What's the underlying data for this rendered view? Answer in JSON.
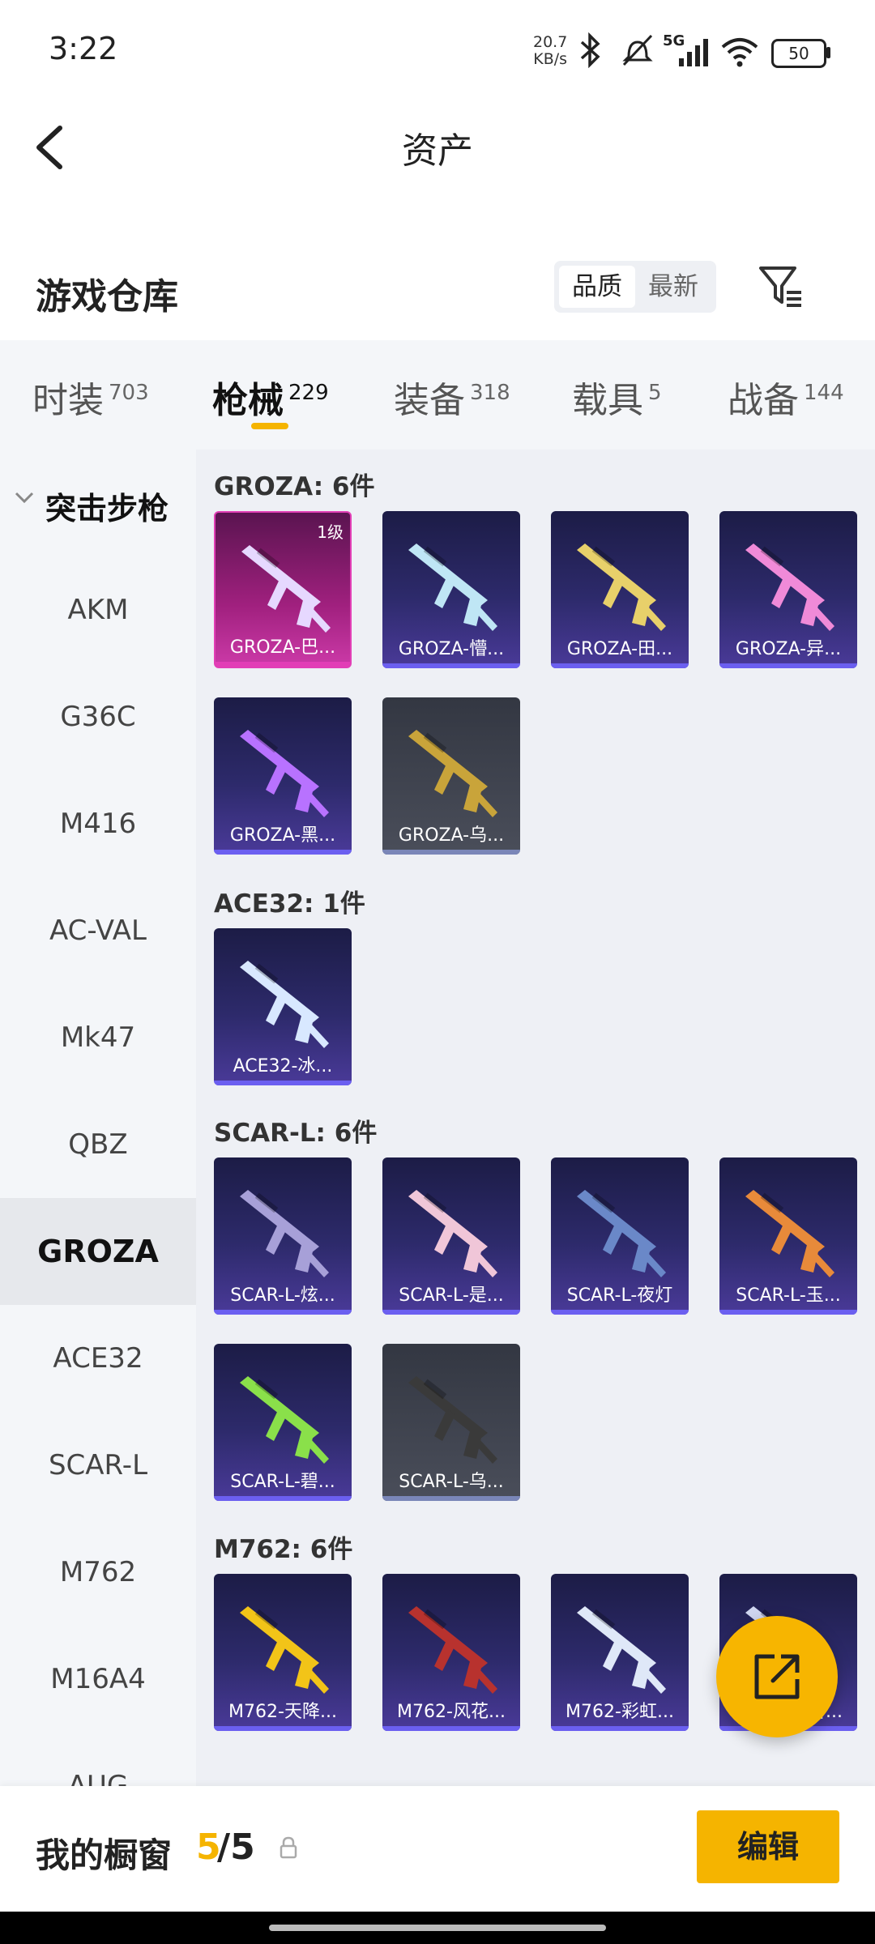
{
  "status": {
    "time": "3:22",
    "net_speed": "20.7",
    "net_unit": "KB/s",
    "battery": "50",
    "signal_label": "5G"
  },
  "header": {
    "title": "资产"
  },
  "section": {
    "title": "游戏仓库",
    "sort_options": [
      "品质",
      "最新"
    ]
  },
  "tabs": [
    {
      "label": "时装",
      "count": "703"
    },
    {
      "label": "枪械",
      "count": "229"
    },
    {
      "label": "装备",
      "count": "318"
    },
    {
      "label": "载具",
      "count": "5"
    },
    {
      "label": "战备",
      "count": "144"
    }
  ],
  "sidebar": {
    "group": "突击步枪",
    "items": [
      "AKM",
      "G36C",
      "M416",
      "AC-VAL",
      "Mk47",
      "QBZ",
      "GROZA",
      "ACE32",
      "SCAR-L",
      "M762",
      "M16A4",
      "AUG"
    ]
  },
  "categories": [
    {
      "title": "GROZA: 6件",
      "items": [
        {
          "name": "GROZA-巴...",
          "level": "1级",
          "style": "pink",
          "color": "#e6d8ff"
        },
        {
          "name": "GROZA-懵...",
          "style": "blue",
          "color": "#bfe6f5"
        },
        {
          "name": "GROZA-田...",
          "style": "blue",
          "color": "#e8d06a"
        },
        {
          "name": "GROZA-异...",
          "style": "blue",
          "color": "#f08ad8"
        },
        {
          "name": "GROZA-黑...",
          "style": "blue",
          "color": "#b872ff"
        },
        {
          "name": "GROZA-乌...",
          "style": "gray",
          "color": "#c9a43a"
        }
      ]
    },
    {
      "title": "ACE32: 1件",
      "items": [
        {
          "name": "ACE32-冰...",
          "style": "blue",
          "color": "#d8e8ff"
        }
      ]
    },
    {
      "title": "SCAR-L: 6件",
      "items": [
        {
          "name": "SCAR-L-炫...",
          "style": "blue",
          "color": "#a7a0d8"
        },
        {
          "name": "SCAR-L-是...",
          "style": "blue",
          "color": "#f0c6d8"
        },
        {
          "name": "SCAR-L-夜灯",
          "style": "blue",
          "color": "#6a88c8"
        },
        {
          "name": "SCAR-L-玉...",
          "style": "blue",
          "color": "#e88a3a"
        },
        {
          "name": "SCAR-L-碧...",
          "style": "blue",
          "color": "#8ae04a"
        },
        {
          "name": "SCAR-L-乌...",
          "style": "gray",
          "color": "#3a3a3a"
        }
      ]
    },
    {
      "title": "M762: 6件",
      "items": [
        {
          "name": "M762-天降...",
          "style": "blue",
          "color": "#f2c418"
        },
        {
          "name": "M762-风花...",
          "style": "blue",
          "color": "#b8322e"
        },
        {
          "name": "M762-彩虹...",
          "style": "blue",
          "color": "#dfe8f8"
        },
        {
          "name": "M762-赋雪...",
          "style": "blue",
          "color": "#d0d6f0"
        }
      ]
    }
  ],
  "bottom": {
    "label": "我的橱窗",
    "count_current": "5",
    "count_sep": "/5",
    "edit_label": "编辑"
  },
  "colors": {
    "accent": "#f5b400",
    "card_blue": "#2d2a6b",
    "card_pink": "#cc3aa8",
    "card_gray": "#4a4e5a"
  }
}
